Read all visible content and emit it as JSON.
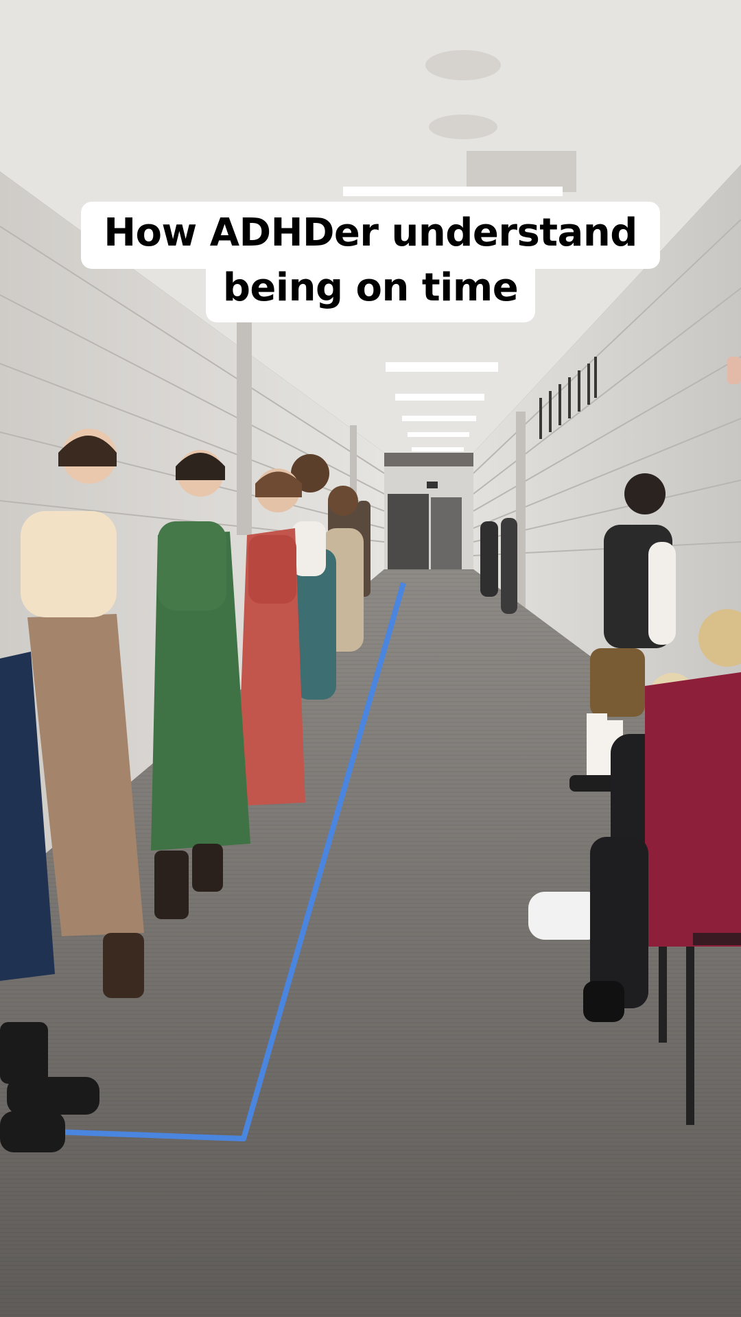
{
  "caption": {
    "line1": "How ADHDer understand",
    "line2": "being on time"
  },
  "colors": {
    "wall": "#d8d6d3",
    "ceiling": "#e4e2de",
    "floor": "#6e6b68",
    "tape": "#4a86e0",
    "caption_bg": "#ffffff",
    "caption_text": "#000000"
  }
}
